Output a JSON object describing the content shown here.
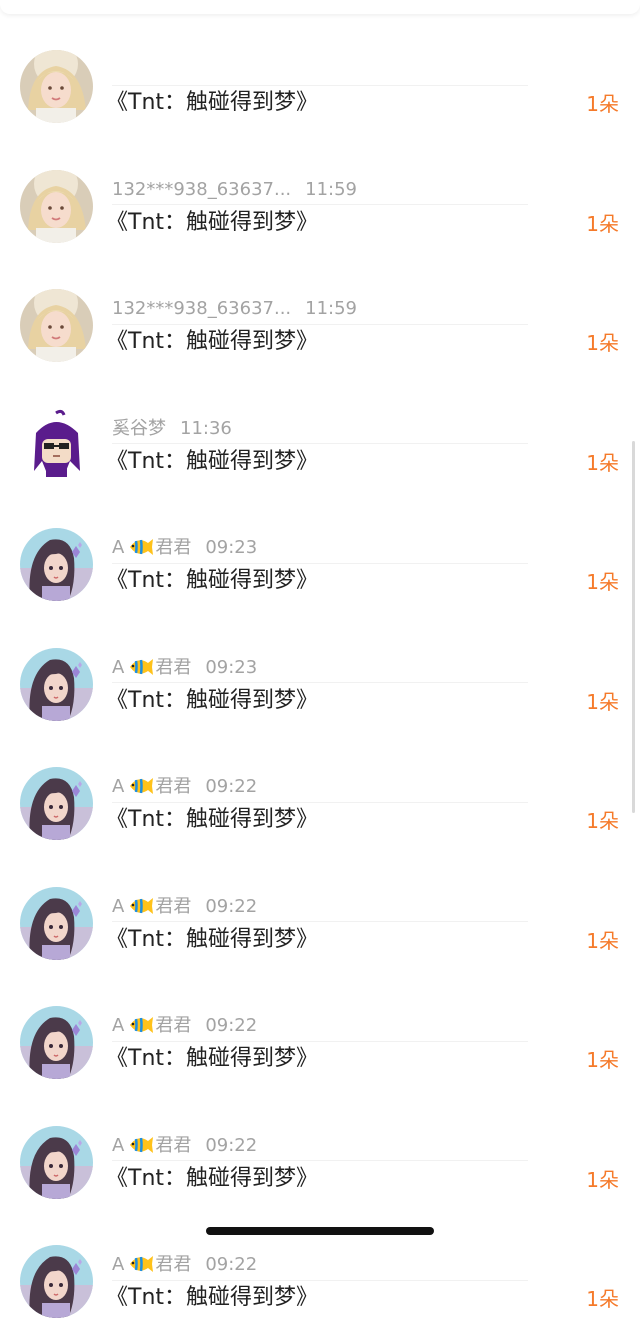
{
  "colors": {
    "name_gray": "#a3a3a3",
    "gift_text": "#222222",
    "qty_orange": "#f57a2a",
    "divider": "#f1f1f1"
  },
  "rows": [
    {
      "avatar": "lolita-avatar",
      "name": "",
      "time": "",
      "fish": false,
      "gift": "《Tnt：触碰得到梦》",
      "qty": "1朵"
    },
    {
      "avatar": "lolita-avatar",
      "name": "132***938_63637...",
      "time": "11:59",
      "fish": false,
      "gift": "《Tnt：触碰得到梦》",
      "qty": "1朵"
    },
    {
      "avatar": "lolita-avatar",
      "name": "132***938_63637...",
      "time": "11:59",
      "fish": false,
      "gift": "《Tnt：触碰得到梦》",
      "qty": "1朵"
    },
    {
      "avatar": "purple-hair-avatar",
      "name": "奚谷梦",
      "time": "11:36",
      "fish": false,
      "gift": "《Tnt：触碰得到梦》",
      "qty": "1朵"
    },
    {
      "avatar": "anime-girl-avatar",
      "name_prefix": "A",
      "name_suffix": "君君",
      "time": "09:23",
      "fish": true,
      "gift": "《Tnt：触碰得到梦》",
      "qty": "1朵"
    },
    {
      "avatar": "anime-girl-avatar",
      "name_prefix": "A",
      "name_suffix": "君君",
      "time": "09:23",
      "fish": true,
      "gift": "《Tnt：触碰得到梦》",
      "qty": "1朵"
    },
    {
      "avatar": "anime-girl-avatar",
      "name_prefix": "A",
      "name_suffix": "君君",
      "time": "09:22",
      "fish": true,
      "gift": "《Tnt：触碰得到梦》",
      "qty": "1朵"
    },
    {
      "avatar": "anime-girl-avatar",
      "name_prefix": "A",
      "name_suffix": "君君",
      "time": "09:22",
      "fish": true,
      "gift": "《Tnt：触碰得到梦》",
      "qty": "1朵"
    },
    {
      "avatar": "anime-girl-avatar",
      "name_prefix": "A",
      "name_suffix": "君君",
      "time": "09:22",
      "fish": true,
      "gift": "《Tnt：触碰得到梦》",
      "qty": "1朵"
    },
    {
      "avatar": "anime-girl-avatar",
      "name_prefix": "A",
      "name_suffix": "君君",
      "time": "09:22",
      "fish": true,
      "gift": "《Tnt：触碰得到梦》",
      "qty": "1朵"
    },
    {
      "avatar": "anime-girl-avatar",
      "name_prefix": "A",
      "name_suffix": "君君",
      "time": "09:22",
      "fish": true,
      "gift": "《Tnt：触碰得到梦》",
      "qty": "1朵"
    }
  ]
}
